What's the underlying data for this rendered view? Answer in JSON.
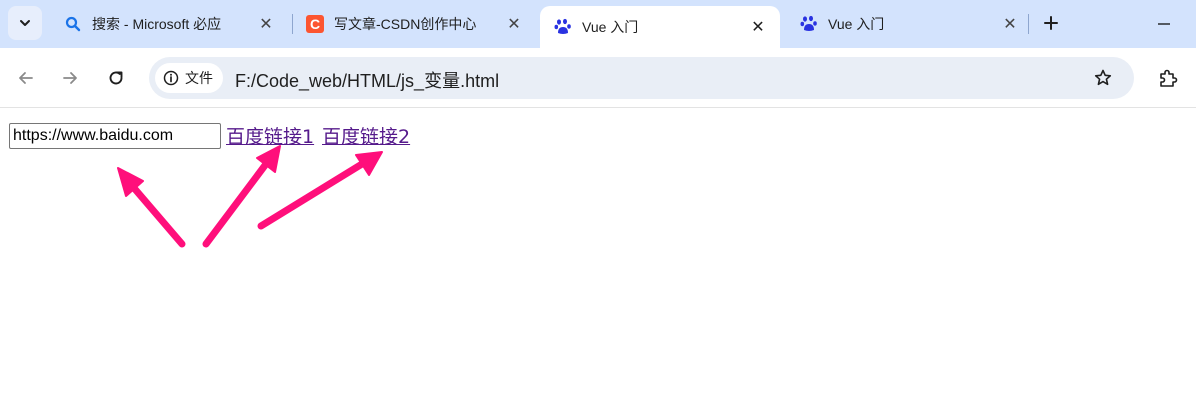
{
  "tabs": [
    {
      "title": "搜索 - Microsoft 必应",
      "favicon": "search-icon",
      "active": false
    },
    {
      "title": "写文章-CSDN创作中心",
      "favicon": "csdn-logo-icon",
      "active": false
    },
    {
      "title": "Vue 入门",
      "favicon": "baidu-paw-icon",
      "active": true
    },
    {
      "title": "Vue 入门",
      "favicon": "baidu-paw-icon",
      "active": false
    }
  ],
  "toolbar": {
    "site_info_label": "文件",
    "url": "F:/Code_web/HTML/js_变量.html"
  },
  "page": {
    "input_value": "https://www.baidu.com",
    "link1": "百度链接1",
    "link2": "百度链接2"
  },
  "colors": {
    "tabstrip_bg": "#d3e3fd",
    "omnibox_bg": "#e9eef6",
    "arrow": "#ff0f7b",
    "visited_link": "#551a8b",
    "csdn_orange": "#fc5531",
    "baidu_blue": "#2932e1"
  }
}
